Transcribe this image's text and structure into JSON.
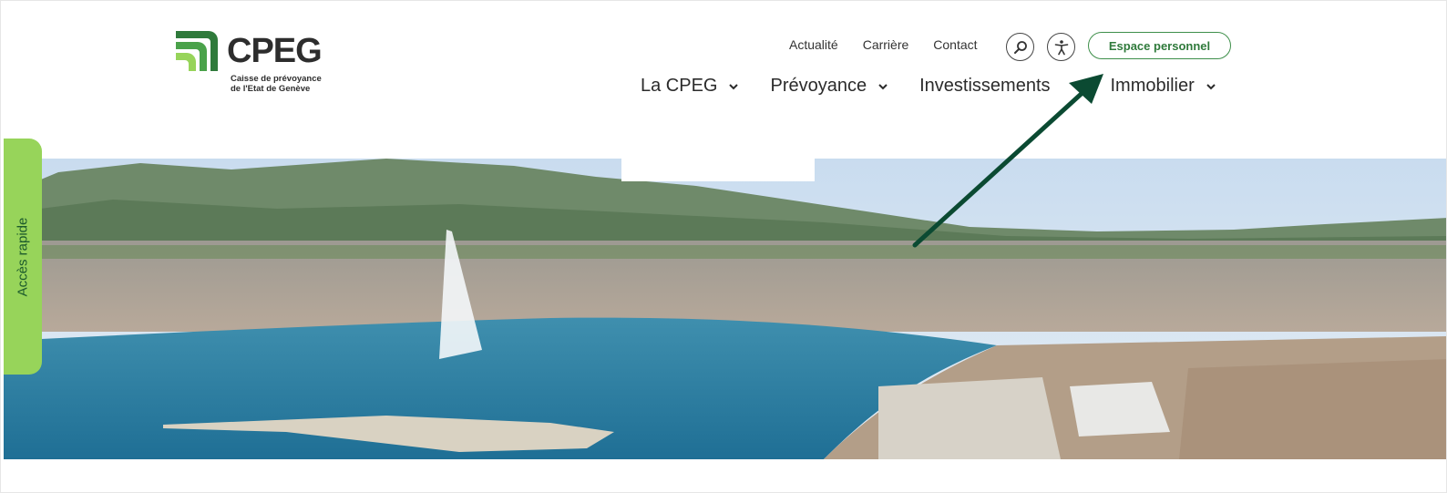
{
  "brand": {
    "name": "CPEG",
    "subtitle_line1": "Caisse de prévoyance",
    "subtitle_line2": "de l'Etat de Genève"
  },
  "top_links": [
    "Actualité",
    "Carrière",
    "Contact"
  ],
  "icons": {
    "search": "search-icon",
    "accessibility": "accessibility-icon"
  },
  "espace_button": "Espace personnel",
  "main_nav": {
    "items": [
      {
        "label": "La CPEG"
      },
      {
        "label": "Prévoyance"
      },
      {
        "label": "Investissements"
      },
      {
        "label": "Immobilier"
      }
    ]
  },
  "side_tab": "Accès rapide",
  "colors": {
    "brand_green": "#2f7a3b",
    "light_green": "#97d45a",
    "annotation_arrow": "#0b4a32"
  }
}
